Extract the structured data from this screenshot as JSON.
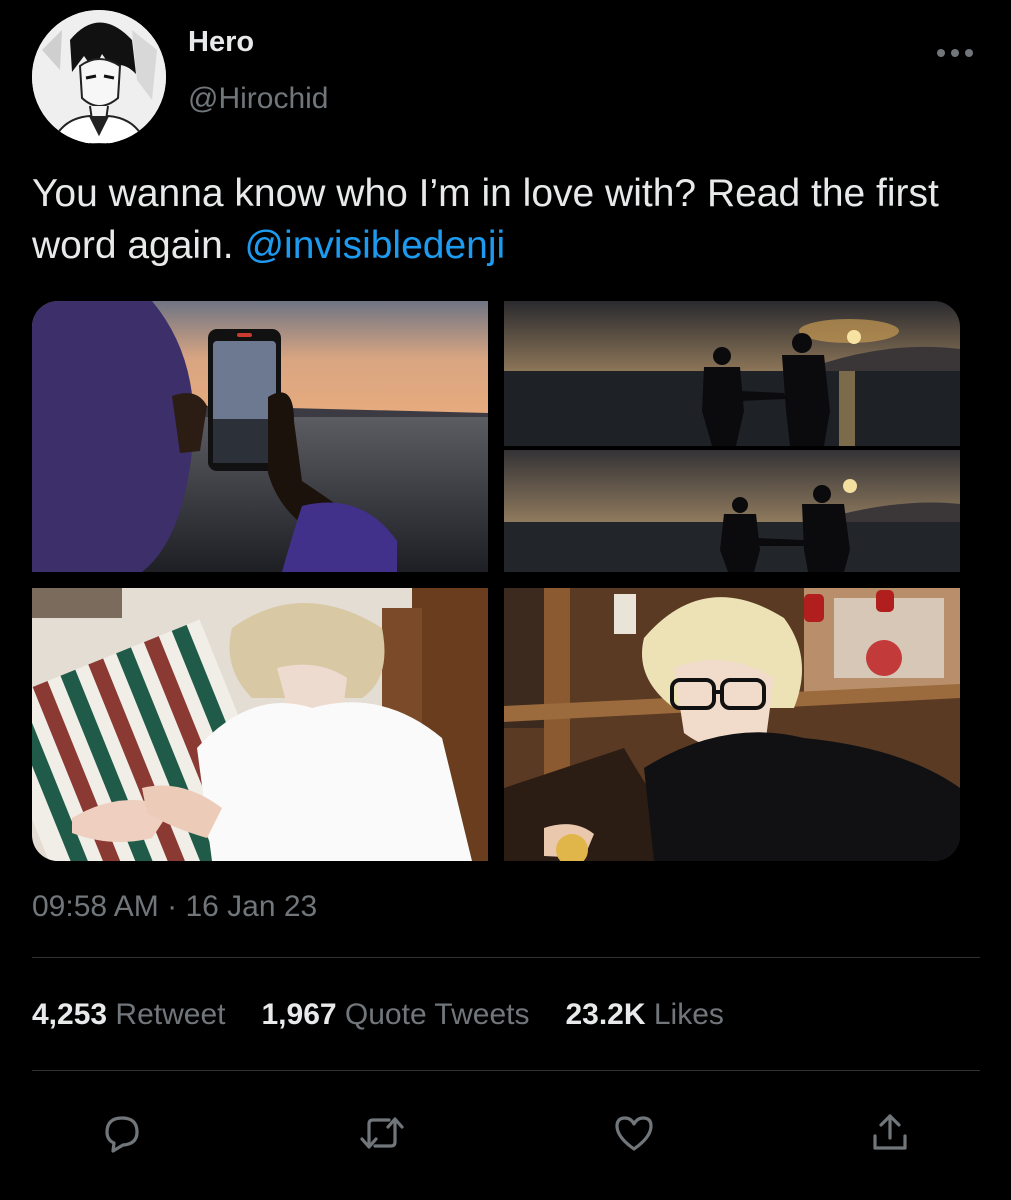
{
  "author": {
    "display_name": "Hero",
    "handle": "@Hirochid"
  },
  "tweet": {
    "text": "You wanna know who I’m in love with? Read the first word again. ",
    "mention": "@invisibledenji"
  },
  "media": [
    {
      "name": "photo-phone-sunset-sea"
    },
    {
      "name": "photo-couple-silhouette-1"
    },
    {
      "name": "photo-couple-silhouette-2"
    },
    {
      "name": "photo-blonde-white-shirt-beach"
    },
    {
      "name": "photo-blonde-glasses-restaurant"
    }
  ],
  "meta": {
    "time": "09:58 AM",
    "separator": " · ",
    "date": "16 Jan 23"
  },
  "stats": [
    {
      "value": "4,253",
      "label": "Retweet"
    },
    {
      "value": "1,967",
      "label": "Quote Tweets"
    },
    {
      "value": "23.2K",
      "label": "Likes"
    }
  ],
  "actions": [
    "reply-icon",
    "retweet-icon",
    "like-icon",
    "share-icon"
  ],
  "colors": {
    "background": "#000000",
    "text": "#e7e9ea",
    "secondary": "#71767b",
    "link": "#1d9bf0",
    "divider": "#2f3336"
  }
}
